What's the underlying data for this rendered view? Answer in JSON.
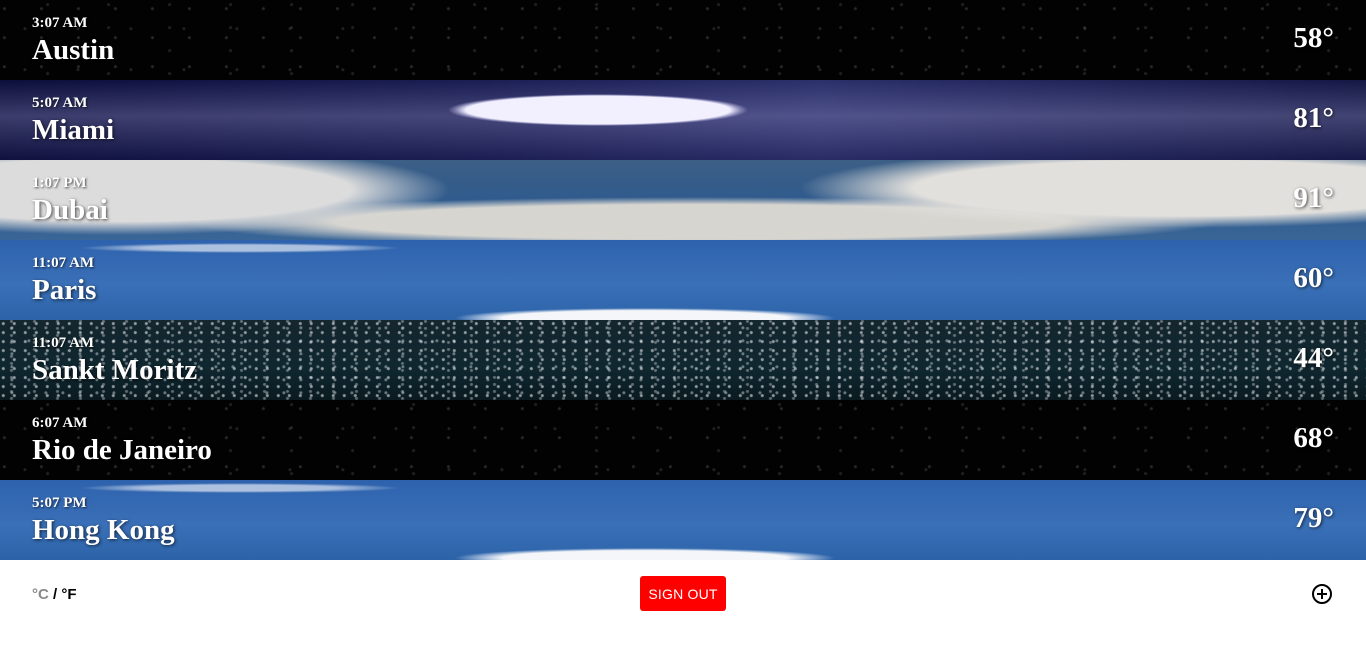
{
  "cities": [
    {
      "time": "3:07 AM",
      "name": "Austin",
      "temp": "58°",
      "scene": "night"
    },
    {
      "time": "5:07 AM",
      "name": "Miami",
      "temp": "81°",
      "scene": "moon"
    },
    {
      "time": "1:07 PM",
      "name": "Dubai",
      "temp": "91°",
      "scene": "cloudy"
    },
    {
      "time": "11:07 AM",
      "name": "Paris",
      "temp": "60°",
      "scene": "sky"
    },
    {
      "time": "11:07 AM",
      "name": "Sankt Moritz",
      "temp": "44°",
      "scene": "snow"
    },
    {
      "time": "6:07 AM",
      "name": "Rio de Janeiro",
      "temp": "68°",
      "scene": "night"
    },
    {
      "time": "5:07 PM",
      "name": "Hong Kong",
      "temp": "79°",
      "scene": "sky"
    }
  ],
  "footer": {
    "celsius": "°C",
    "separator": " / ",
    "fahrenheit": "°F",
    "sign_out_label": "SIGN OUT",
    "add_icon": "plus-circle-icon"
  },
  "colors": {
    "sign_out": "#ff0000",
    "unit_inactive": "#8a8a8a",
    "unit_active": "#000000"
  }
}
